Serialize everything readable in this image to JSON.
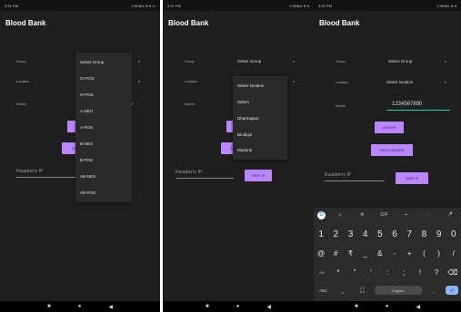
{
  "app": {
    "title": "Blood Bank"
  },
  "screen1": {
    "status_time": "3:31 PM",
    "status_right": "0.0KB/s ⊘ ▾ ▭",
    "labels": {
      "group": "Group",
      "location": "Location",
      "mobile": "Mobile"
    },
    "mobile_value": "0",
    "button_partial": "VIE",
    "ip_placeholder": "Raspberry IP",
    "dropdown": {
      "header": "Select Group",
      "options": [
        "O+POS",
        "O-POS",
        "A-NEG",
        "A-POS",
        "B-NEG",
        "B-POS",
        "AB-NEG",
        "AB-POS"
      ]
    }
  },
  "screen2": {
    "status_time": "3:31 PM",
    "status_right": "0.0KB/s ⊘ ▾",
    "labels": {
      "group": "Group",
      "location": "Location",
      "mobile": "Mobile"
    },
    "group_value": "Select Group",
    "mobile_value": "0",
    "button_partial": "VIE",
    "ip_placeholder": "Raspberry IP",
    "save_ip": "SAVE IP",
    "dropdown": {
      "header": "Select location",
      "options": [
        "Selem",
        "Dharmapuri",
        "Dindigul",
        "Madurai"
      ]
    }
  },
  "screen3": {
    "status_time": "3:32 PM",
    "status_right": "0.0KB/s ⊘ ▾",
    "labels": {
      "group": "Group",
      "location": "Location",
      "mobile": "Mobile"
    },
    "group_value": "Select Group",
    "location_value": "Select location",
    "mobile_value": "1234567890",
    "update": "UPDATE",
    "view_donors": "VIEW DONORS",
    "ip_placeholder": "Raspberry IP",
    "save_ip": "SAVE IP",
    "keyboard": {
      "toolbar": [
        "G",
        "☺",
        "⚙",
        "GIF",
        "⌖",
        "⋯",
        "🎤"
      ],
      "row1": [
        "1",
        "2",
        "3",
        "4",
        "5",
        "6",
        "7",
        "8",
        "9",
        "0"
      ],
      "row2": [
        "@",
        "#",
        "₹",
        "_",
        "&",
        "-",
        "+",
        "(",
        ")",
        "/"
      ],
      "row3": [
        "=\\<",
        "*",
        "\"",
        "'",
        ":",
        ";",
        "!",
        "?",
        "⌫"
      ],
      "row4_left": "ABC",
      "row4_comma": ",",
      "row4_numpad": "1 2\n3 4",
      "space_label": "English",
      "row4_period": ".",
      "enter": "✓"
    }
  },
  "nav": {
    "square": "■",
    "circle": "●",
    "back": "◀"
  }
}
